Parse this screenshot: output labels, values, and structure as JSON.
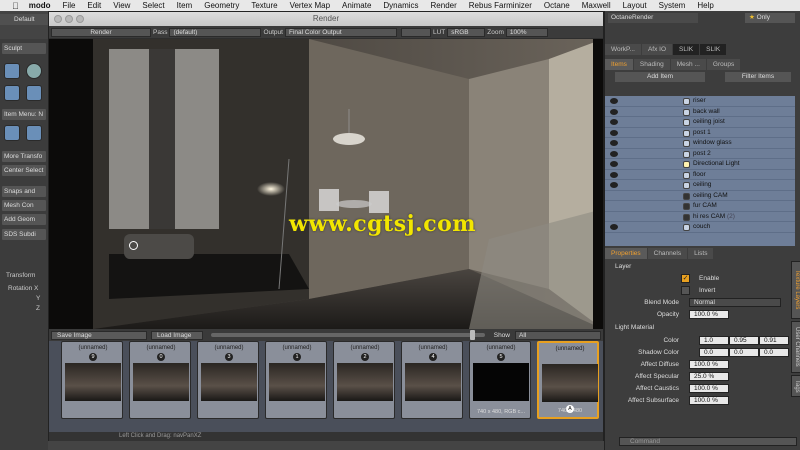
{
  "menubar": {
    "app": "modo",
    "items": [
      "File",
      "Edit",
      "View",
      "Select",
      "Item",
      "Geometry",
      "Texture",
      "Vertex Map",
      "Animate",
      "Dynamics",
      "Render",
      "Rebus Farminizer",
      "Octane",
      "Maxwell",
      "Layout",
      "System",
      "Help"
    ]
  },
  "left": {
    "layout_label": "Default",
    "sculpt": "Sculpt",
    "item_menu": "Item Menu: N",
    "buttons": [
      "More Transfo",
      "Center Select",
      "Snaps and",
      "Mesh Con",
      "Add Geom",
      "SDS Subdi"
    ],
    "transform": "Transform",
    "rotation_x": "Rotation X",
    "y": "Y",
    "z": "Z"
  },
  "render_window": {
    "title": "Render",
    "toolbar": {
      "render_btn": "Render",
      "pass_label": "Pass",
      "pass_value": "(default)",
      "output_label": "Output",
      "output_value": "Final Color Output",
      "lut_label": "LUT",
      "lut_value": "sRGB",
      "zoom_label": "Zoom",
      "zoom_value": "100%"
    },
    "watermark": "www.cgtsj.com",
    "save_image": "Save Image",
    "load_image": "Load Image",
    "show_label": "Show",
    "show_value": "All",
    "status": "Left Click and Drag:  navPanXZ"
  },
  "thumbnails": [
    {
      "name": "(unnamed)",
      "num": "9",
      "dim": ""
    },
    {
      "name": "(unnamed)",
      "num": "0",
      "dim": ""
    },
    {
      "name": "(unnamed)",
      "num": "3",
      "dim": ""
    },
    {
      "name": "(unnamed)",
      "num": "1",
      "dim": ""
    },
    {
      "name": "(unnamed)",
      "num": "2",
      "dim": ""
    },
    {
      "name": "(unnamed)",
      "num": "4",
      "dim": ""
    },
    {
      "name": "(unnamed)",
      "num": "5",
      "dim": "740 x 480, RGB c..."
    },
    {
      "name": "(unnamed)",
      "num": "A",
      "dim": "740 x 480"
    }
  ],
  "right_panel": {
    "octane_render": "OctaneRender",
    "only": "Only",
    "tool_tabs": [
      "WorkP...",
      "Afx IO",
      "SLIK",
      "SLIK"
    ],
    "item_tabs": [
      "Items",
      "Shading",
      "Mesh ...",
      "Groups"
    ],
    "add_item": "Add Item",
    "filter_items": "Filter Items",
    "items": [
      "riser",
      "back wall",
      "ceiling joist",
      "post 1",
      "window glass",
      "post 2",
      "Directional Light",
      "floor",
      "ceiling",
      "ceiling CAM",
      "fur CAM",
      "hi res CAM",
      "couch"
    ],
    "hi_res_count": "(2)",
    "prop_tabs": [
      "Properties",
      "Channels",
      "Lists"
    ],
    "layer_hdr": "Layer",
    "enable": "Enable",
    "invert": "Invert",
    "blend_mode_lbl": "Blend Mode",
    "blend_mode_val": "Normal",
    "opacity_lbl": "Opacity",
    "opacity_val": "100.0 %",
    "light_material_hdr": "Light Material",
    "color_lbl": "Color",
    "color_vals": [
      "1.0",
      "0.95",
      "0.91"
    ],
    "shadow_color_lbl": "Shadow Color",
    "shadow_vals": [
      "0.0",
      "0.0",
      "0.0"
    ],
    "affect_diffuse_lbl": "Affect Diffuse",
    "affect_diffuse_val": "100.0 %",
    "affect_specular_lbl": "Affect Specular",
    "affect_specular_val": "25.0 %",
    "affect_caustics_lbl": "Affect Caustics",
    "affect_caustics_val": "100.0 %",
    "affect_subsurface_lbl": "Affect Subsurface",
    "affect_subsurface_val": "100.0 %",
    "vtabs": [
      "Texture Layers",
      "User Channels",
      "Tags"
    ],
    "command_placeholder": "Command"
  }
}
